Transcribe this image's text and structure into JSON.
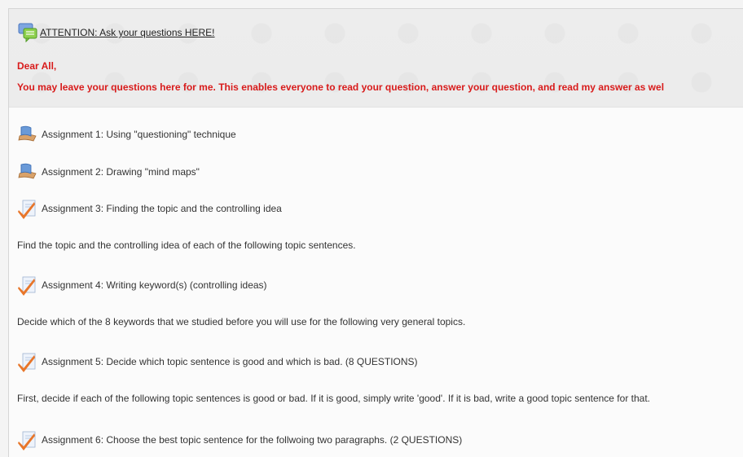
{
  "forum": {
    "icon": "forum-chat-icon",
    "link_text": "ATTENTION: Ask your questions HERE!"
  },
  "announcement": {
    "greeting": "Dear All,",
    "message": "You may leave your questions here for me. This enables everyone to read your question, answer your question, and read my answer as wel"
  },
  "items": [
    {
      "icon": "book-icon",
      "label": "Assignment 1: Using \"questioning\" technique"
    },
    {
      "icon": "book-icon",
      "label": "Assignment 2: Drawing \"mind maps\""
    },
    {
      "icon": "quiz-check-icon",
      "label": "Assignment 3: Finding the topic and the controlling idea",
      "description": "Find the topic and the controlling idea of each of the following topic sentences."
    },
    {
      "icon": "quiz-check-icon",
      "label": "Assignment 4: Writing keyword(s) (controlling ideas)",
      "description": "Decide which of the 8 keywords that we studied before you will use for the following very general topics."
    },
    {
      "icon": "quiz-check-icon",
      "label": "Assignment 5: Decide which topic sentence is good and which is bad. (8 QUESTIONS)",
      "description": "First, decide if each of the following topic sentences is good or bad. If it is good, simply write 'good'. If it is bad, write a good topic sentence for that."
    },
    {
      "icon": "quiz-check-icon",
      "label": "Assignment 6: Choose the best topic sentence for the follwoing two paragraphs. (2 QUESTIONS)"
    }
  ],
  "colors": {
    "announcement_text": "#d81b1b",
    "check_mark": "#e8762a",
    "book": "#6a9ad8"
  }
}
